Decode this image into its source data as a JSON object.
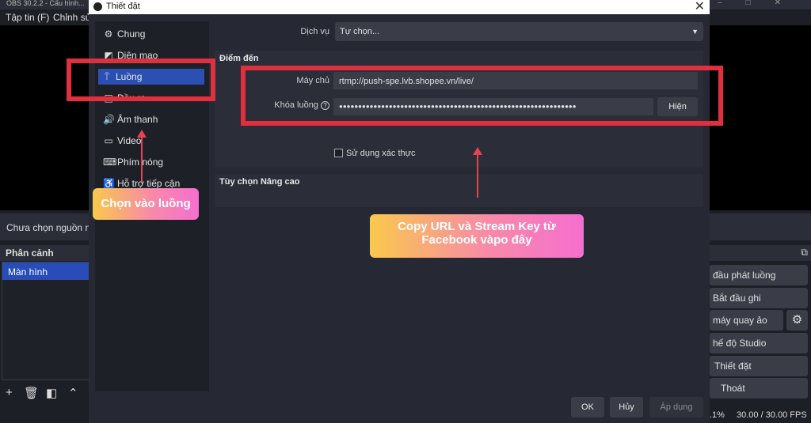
{
  "main_window": {
    "title": "OBS 30.2.2 - Cấu hình...",
    "menu": [
      "Tập tin (F)",
      "Chỉnh sửa"
    ],
    "source_status": "Chưa chọn nguồn nào",
    "scenes_header": "Phân cảnh",
    "scenes": [
      "Màn hình"
    ],
    "controls": [
      "đầu phát luồng",
      "Bắt đầu ghi",
      "máy quay ảo",
      "hế độ Studio",
      "Thiết đặt",
      "Thoát"
    ],
    "status": {
      "cpu": ".1%",
      "fps": "30.00 / 30.00 FPS"
    }
  },
  "dialog": {
    "title": "Thiết đặt",
    "sidebar": [
      {
        "label": "Chung",
        "icon": "gear-icon"
      },
      {
        "label": "Diện mạo",
        "icon": "palette-icon"
      },
      {
        "label": "Luồng",
        "icon": "antenna-icon"
      },
      {
        "label": "Đầu ra",
        "icon": "output-icon"
      },
      {
        "label": "Âm thanh",
        "icon": "speaker-icon"
      },
      {
        "label": "Video",
        "icon": "monitor-icon"
      },
      {
        "label": "Phím nóng",
        "icon": "keyboard-icon"
      },
      {
        "label": "Hỗ trợ tiếp cận",
        "icon": "accessibility-icon"
      }
    ],
    "service_label": "Dịch vụ",
    "service_value": "Tự chọn...",
    "destination_title": "Điểm đến",
    "server_label": "Máy chủ",
    "server_value": "rtmp://push-spe.lvb.shopee.vn/live/",
    "key_label": "Khóa luồng",
    "key_value": "●●●●●●●●●●●●●●●●●●●●●●●●●●●●●●●●●●●●●●●●●●●●●●●●●●●●●●●●●●●●●●",
    "show_button": "Hiện",
    "auth_checkbox": "Sử dụng xác thực",
    "advanced_title": "Tùy chọn Nâng cao",
    "buttons": {
      "ok": "OK",
      "cancel": "Hủy",
      "apply": "Áp dụng"
    }
  },
  "annotations": {
    "callout_left": "Chọn vào luồng",
    "callout_right": "Copy URL và Stream Key từ Facebook vàpo đây"
  },
  "colors": {
    "accent": "#2c4fb4",
    "annotation_red": "#e0303e"
  }
}
